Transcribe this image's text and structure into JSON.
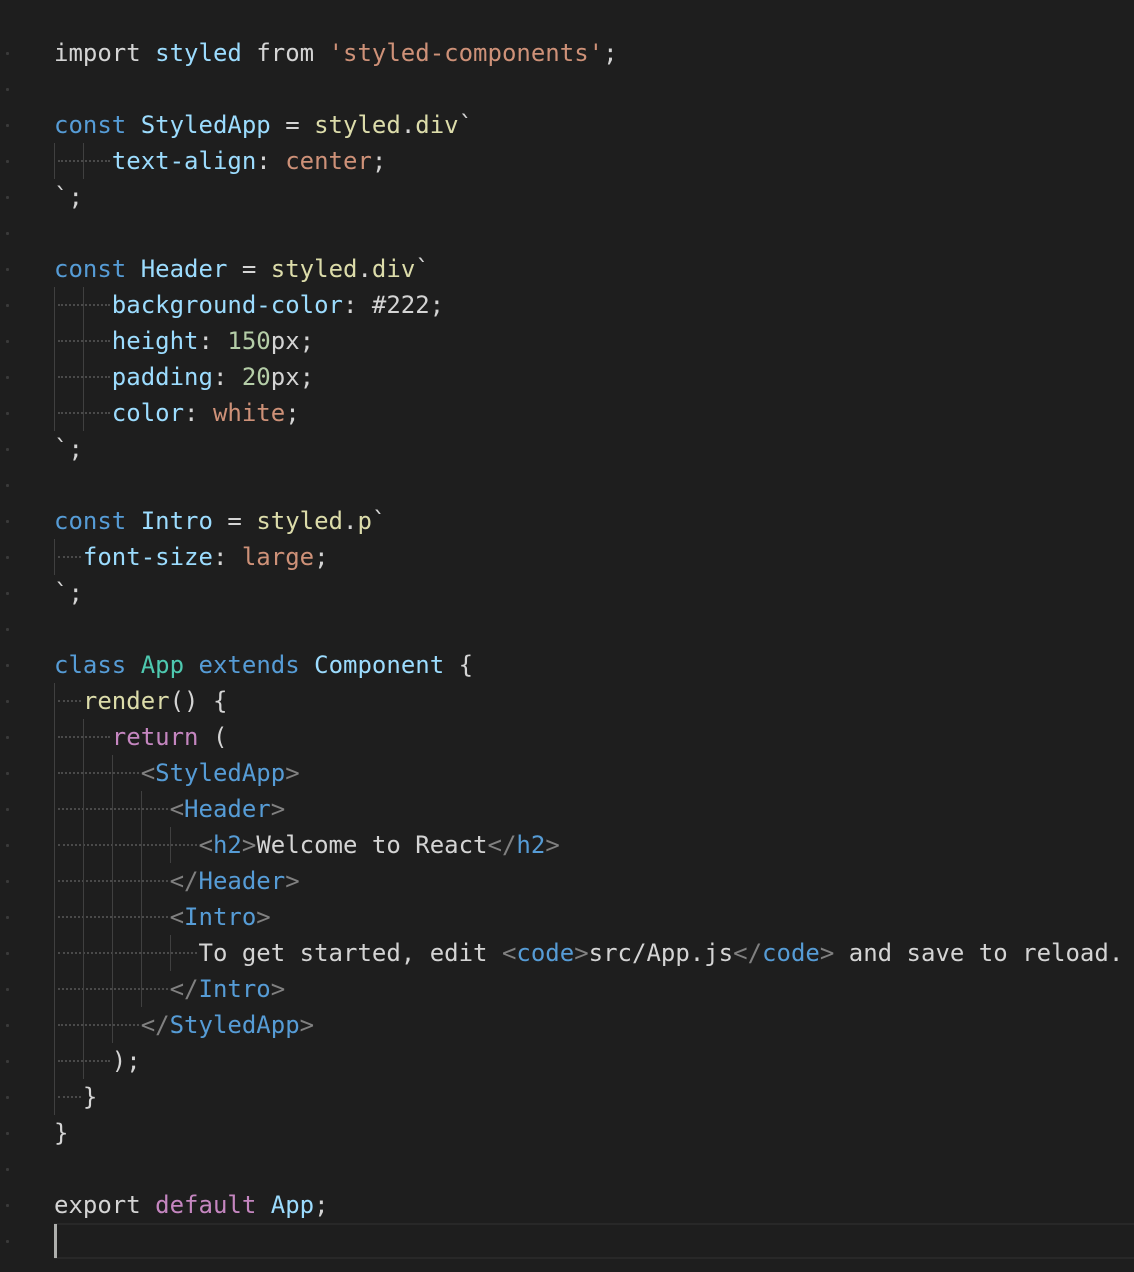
{
  "editor": {
    "colors": {
      "background": "#1e1e1e",
      "default": "#d4d4d4",
      "keyword": "#569cd6",
      "control": "#c586c0",
      "variable": "#9cdcfe",
      "function": "#dcdcaa",
      "class": "#4ec9b0",
      "string": "#ce9178",
      "number": "#b5cea8",
      "tag_bracket": "#808080"
    },
    "lines": [
      [
        [
          "kw2",
          "import"
        ],
        [
          "txt",
          " "
        ],
        [
          "var",
          "styled"
        ],
        [
          "txt",
          " "
        ],
        [
          "kw2",
          "from"
        ],
        [
          "txt",
          " "
        ],
        [
          "str",
          "'styled-components'"
        ],
        [
          "txt",
          ";"
        ]
      ],
      [],
      [
        [
          "kw",
          "const"
        ],
        [
          "txt",
          " "
        ],
        [
          "var",
          "StyledApp"
        ],
        [
          "txt",
          " = "
        ],
        [
          "fn",
          "styled"
        ],
        [
          "txt",
          "."
        ],
        [
          "fn",
          "div"
        ],
        [
          "txt",
          "`"
        ]
      ],
      [
        [
          "ws",
          "    "
        ],
        [
          "var",
          "text-align"
        ],
        [
          "txt",
          ": "
        ],
        [
          "str",
          "center"
        ],
        [
          "txt",
          ";"
        ]
      ],
      [
        [
          "txt",
          "`;"
        ]
      ],
      [],
      [
        [
          "kw",
          "const"
        ],
        [
          "txt",
          " "
        ],
        [
          "var",
          "Header"
        ],
        [
          "txt",
          " = "
        ],
        [
          "fn",
          "styled"
        ],
        [
          "txt",
          "."
        ],
        [
          "fn",
          "div"
        ],
        [
          "txt",
          "`"
        ]
      ],
      [
        [
          "ws",
          "    "
        ],
        [
          "var",
          "background-color"
        ],
        [
          "txt",
          ": #222;"
        ]
      ],
      [
        [
          "ws",
          "    "
        ],
        [
          "var",
          "height"
        ],
        [
          "txt",
          ": "
        ],
        [
          "num",
          "150"
        ],
        [
          "txt",
          "px;"
        ]
      ],
      [
        [
          "ws",
          "    "
        ],
        [
          "var",
          "padding"
        ],
        [
          "txt",
          ": "
        ],
        [
          "num",
          "20"
        ],
        [
          "txt",
          "px;"
        ]
      ],
      [
        [
          "ws",
          "    "
        ],
        [
          "var",
          "color"
        ],
        [
          "txt",
          ": "
        ],
        [
          "str",
          "white"
        ],
        [
          "txt",
          ";"
        ]
      ],
      [
        [
          "txt",
          "`;"
        ]
      ],
      [],
      [
        [
          "kw",
          "const"
        ],
        [
          "txt",
          " "
        ],
        [
          "var",
          "Intro"
        ],
        [
          "txt",
          " = "
        ],
        [
          "fn",
          "styled"
        ],
        [
          "txt",
          "."
        ],
        [
          "fn",
          "p"
        ],
        [
          "txt",
          "`"
        ]
      ],
      [
        [
          "ws",
          "  "
        ],
        [
          "var",
          "font-size"
        ],
        [
          "txt",
          ": "
        ],
        [
          "str",
          "large"
        ],
        [
          "txt",
          ";"
        ]
      ],
      [
        [
          "txt",
          "`;"
        ]
      ],
      [],
      [
        [
          "kw",
          "class"
        ],
        [
          "txt",
          " "
        ],
        [
          "cls",
          "App"
        ],
        [
          "txt",
          " "
        ],
        [
          "kw",
          "extends"
        ],
        [
          "txt",
          " "
        ],
        [
          "var",
          "Component"
        ],
        [
          "txt",
          " {"
        ]
      ],
      [
        [
          "ws",
          "  "
        ],
        [
          "fn",
          "render"
        ],
        [
          "txt",
          "() {"
        ]
      ],
      [
        [
          "ws",
          "    "
        ],
        [
          "ctrl",
          "return"
        ],
        [
          "txt",
          " ("
        ]
      ],
      [
        [
          "ws",
          "      "
        ],
        [
          "punc",
          "<"
        ],
        [
          "tag",
          "StyledApp"
        ],
        [
          "punc",
          ">"
        ]
      ],
      [
        [
          "ws",
          "        "
        ],
        [
          "punc",
          "<"
        ],
        [
          "tag",
          "Header"
        ],
        [
          "punc",
          ">"
        ]
      ],
      [
        [
          "ws",
          "          "
        ],
        [
          "punc",
          "<"
        ],
        [
          "tag",
          "h2"
        ],
        [
          "punc",
          ">"
        ],
        [
          "txt",
          "Welcome to React"
        ],
        [
          "punc",
          "</"
        ],
        [
          "tag",
          "h2"
        ],
        [
          "punc",
          ">"
        ]
      ],
      [
        [
          "ws",
          "        "
        ],
        [
          "punc",
          "</"
        ],
        [
          "tag",
          "Header"
        ],
        [
          "punc",
          ">"
        ]
      ],
      [
        [
          "ws",
          "        "
        ],
        [
          "punc",
          "<"
        ],
        [
          "tag",
          "Intro"
        ],
        [
          "punc",
          ">"
        ]
      ],
      [
        [
          "ws",
          "          "
        ],
        [
          "txt",
          "To get started, edit "
        ],
        [
          "punc",
          "<"
        ],
        [
          "tag",
          "code"
        ],
        [
          "punc",
          ">"
        ],
        [
          "txt",
          "src/App.js"
        ],
        [
          "punc",
          "</"
        ],
        [
          "tag",
          "code"
        ],
        [
          "punc",
          ">"
        ],
        [
          "txt",
          " and save to reload."
        ]
      ],
      [
        [
          "ws",
          "        "
        ],
        [
          "punc",
          "</"
        ],
        [
          "tag",
          "Intro"
        ],
        [
          "punc",
          ">"
        ]
      ],
      [
        [
          "ws",
          "      "
        ],
        [
          "punc",
          "</"
        ],
        [
          "tag",
          "StyledApp"
        ],
        [
          "punc",
          ">"
        ]
      ],
      [
        [
          "ws",
          "    "
        ],
        [
          "txt",
          ");"
        ]
      ],
      [
        [
          "ws",
          "  "
        ],
        [
          "txt",
          "}"
        ]
      ],
      [
        [
          "txt",
          "}"
        ]
      ],
      [],
      [
        [
          "kw2",
          "export"
        ],
        [
          "txt",
          " "
        ],
        [
          "ctrl",
          "default"
        ],
        [
          "txt",
          " "
        ],
        [
          "var",
          "App"
        ],
        [
          "txt",
          ";"
        ]
      ],
      []
    ]
  }
}
